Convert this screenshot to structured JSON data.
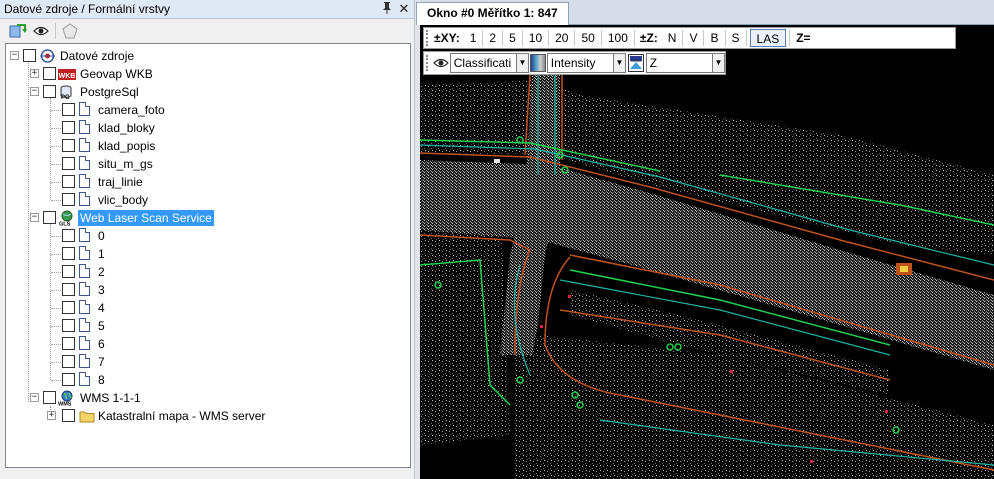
{
  "panel": {
    "title": "Datové zdroje / Formální vrstvy",
    "pin_glyph": "❘",
    "close_glyph": "✕"
  },
  "toolbar": {
    "icons": [
      "refresh-icon",
      "eye-icon",
      "pentagon-icon"
    ]
  },
  "tree": {
    "root": {
      "label": "Datové zdroje",
      "expander": "−"
    },
    "geovap": {
      "label": "Geovap WKB",
      "expander": "+",
      "badge": "WKB"
    },
    "postgres": {
      "label": "PostgreSql",
      "expander": "−",
      "badge": "PG",
      "children": [
        "camera_foto",
        "klad_bloky",
        "klad_popis",
        "situ_m_gs",
        "traj_linie",
        "vlic_body"
      ]
    },
    "wlss": {
      "label": "Web Laser Scan Service",
      "expander": "−",
      "badge": "GLS",
      "children": [
        "0",
        "1",
        "2",
        "3",
        "4",
        "5",
        "6",
        "7",
        "8"
      ]
    },
    "wms": {
      "label": "WMS 1-1-1",
      "expander": "−",
      "badge": "WMS",
      "children": [
        {
          "label": "Katastralní mapa - WMS server",
          "expander": "+"
        }
      ]
    }
  },
  "map_tab": {
    "label": "Okno #0 Měřítko 1:   847"
  },
  "scale_toolbar": {
    "xy_label": "±XY:",
    "xy_values": [
      "1",
      "2",
      "5",
      "10",
      "20",
      "50",
      "100"
    ],
    "z_label": "±Z:",
    "view_buttons": [
      "N",
      "V",
      "B",
      "S"
    ],
    "las_label": "LAS",
    "z_eq_label": "Z="
  },
  "layer_toolbar": {
    "classification_value": "Classificati",
    "intensity_value": "Intensity",
    "z_value": "Z"
  },
  "colors": {
    "tree_selection": "#3399ff",
    "map_background": "#000000",
    "curb_orange": "#c0521e",
    "line_cyan": "#1bb5a5",
    "line_green": "#1fd14f",
    "marker_red": "#e02040"
  }
}
